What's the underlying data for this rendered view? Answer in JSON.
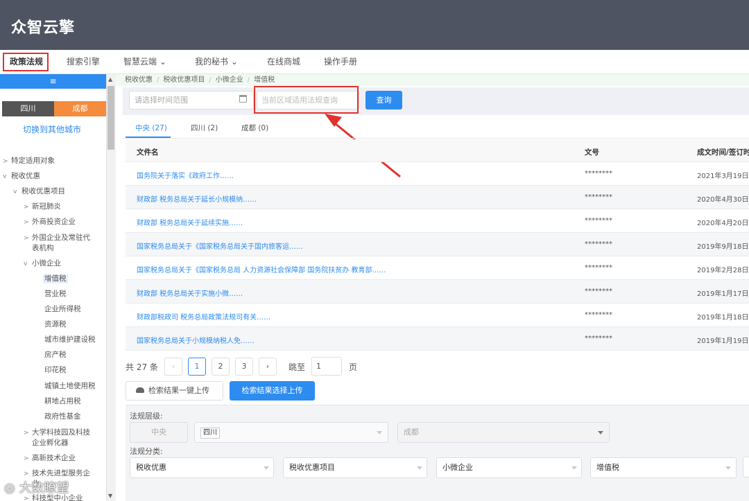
{
  "app": {
    "logo": "众智云擎"
  },
  "nav": {
    "items": [
      "政策法规",
      "搜索引擎",
      "智慧云端",
      "我的秘书",
      "在线商城",
      "操作手册"
    ],
    "chevron": "⌄"
  },
  "sidebar": {
    "toggle_icon": "≡",
    "city_province": "四川",
    "city_current": "成都",
    "switch_city": "切换到其他城市",
    "tree": {
      "t0": "特定适用对象",
      "t1": "税收优惠",
      "t2": "税收优惠项目",
      "t3": "新冠肺炎",
      "t4": "外商投资企业",
      "t5a": "外国企业及常驻代",
      "t5b": "表机构",
      "t6": "小微企业",
      "t7": "增值税",
      "t8": "营业税",
      "t9": "企业所得税",
      "t10": "资源税",
      "t11": "城市维护建设税",
      "t12": "房产税",
      "t13": "印花税",
      "t14": "城镇土地使用税",
      "t15": "耕地占用税",
      "t16": "政府性基金",
      "t17a": "大学科技园及科技",
      "t17b": "企业孵化器",
      "t18": "高新技术企业",
      "t19a": "技术先进型服务企",
      "t19b": "业",
      "t20": "科技型中小企业"
    }
  },
  "breadcrumb": [
    "税收优惠",
    "税收优惠项目",
    "小微企业",
    "增值税"
  ],
  "search": {
    "date_placeholder": "请选择时间范围",
    "region_placeholder": "当前区域适用法规查询",
    "button": "查询"
  },
  "tabs": [
    "中央 (27)",
    "四川 (2)",
    "成都 (0)"
  ],
  "table": {
    "headers": {
      "name": "文件名",
      "number": "文号",
      "date": "成文时间/签订时"
    },
    "rows": [
      {
        "name": "国务院关于落实《政府工作……",
        "number": "********",
        "date": "2021年3月19日"
      },
      {
        "name": "财政部 税务总局关于延长小规模纳……",
        "number": "********",
        "date": "2020年4月30日"
      },
      {
        "name": "财政部 税务总局关于延续实施……",
        "number": "********",
        "date": "2020年4月20日"
      },
      {
        "name": "国家税务总局关于《国家税务总局关于国内旅客运……",
        "number": "********",
        "date": "2019年9月18日"
      },
      {
        "name": "国家税务总局关于《国家税务总局 人力资源社会保障部 国务院扶贫办 教育部……",
        "number": "********",
        "date": "2019年2月28日"
      },
      {
        "name": "财政部 税务总局关于实施小微……",
        "number": "********",
        "date": "2019年1月17日"
      },
      {
        "name": "财政部税政司 税务总局政策法规司有关……",
        "number": "********",
        "date": "2019年1月18日"
      },
      {
        "name": "国家税务总局关于小规模纳税人免……",
        "number": "********",
        "date": "2019年1月19日"
      }
    ]
  },
  "pagination": {
    "total": "共 27 条",
    "prev": "‹",
    "pages": [
      "1",
      "2",
      "3"
    ],
    "next": "›",
    "jump_label": "跳至",
    "jump_value": "1",
    "unit": "页"
  },
  "upload": {
    "one_click": "检索结果一键上传",
    "select": "检索结果选择上传"
  },
  "filter": {
    "level_label": "法规层级:",
    "level_central": "中央",
    "level_province_tag": "四川",
    "level_city": "成都",
    "category_label": "法规分类:",
    "categories": [
      "税收优惠",
      "税收优惠项目",
      "小微企业",
      "增值税"
    ]
  },
  "watermark": "大数瞭望",
  "colors": {
    "accent": "#2d8cf0",
    "highlight": "#e0322d",
    "orange": "#f58b3c",
    "header": "#4f5462"
  }
}
